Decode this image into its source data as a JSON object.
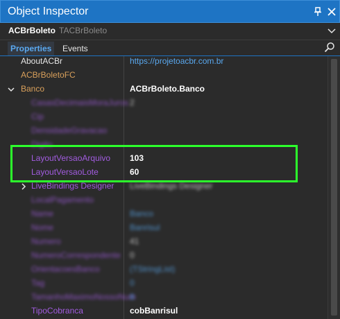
{
  "window": {
    "title": "Object Inspector"
  },
  "selector": {
    "object_name": "ACBrBoleto",
    "class_name": "TACBrBoleto"
  },
  "tabs": [
    {
      "label": "Properties"
    },
    {
      "label": "Events"
    }
  ],
  "properties": [
    {
      "name": "AboutACBr",
      "value": "https://projetoacbr.com.br"
    },
    {
      "name": "ACBrBoletoFC",
      "value": ""
    },
    {
      "name": "Banco",
      "value": "ACBrBoleto.Banco"
    },
    {
      "name": "CasasDecimaisMoraJuros",
      "value": "2"
    },
    {
      "name": "Cip",
      "value": ""
    },
    {
      "name": "DensidadeGravacao",
      "value": ""
    },
    {
      "name": "Digito",
      "value": ""
    },
    {
      "name": "LayoutVersaoArquivo",
      "value": "103"
    },
    {
      "name": "LayoutVersaoLote",
      "value": "60"
    },
    {
      "name": "LiveBindings Designer",
      "value": "LiveBindings Designer"
    },
    {
      "name": "LocalPagamento",
      "value": ""
    },
    {
      "name": "Name",
      "value": "Banco"
    },
    {
      "name": "Nome",
      "value": "Banrisul"
    },
    {
      "name": "Numero",
      "value": "41"
    },
    {
      "name": "NumeroCorrespondente",
      "value": "0"
    },
    {
      "name": "OrientacoesBanco",
      "value": "(TStringList)"
    },
    {
      "name": "Tag",
      "value": "0"
    },
    {
      "name": "TamanhoMaximoNossoNum",
      "value": "8"
    },
    {
      "name": "TipoCobranca",
      "value": "cobBanrisul"
    }
  ]
}
